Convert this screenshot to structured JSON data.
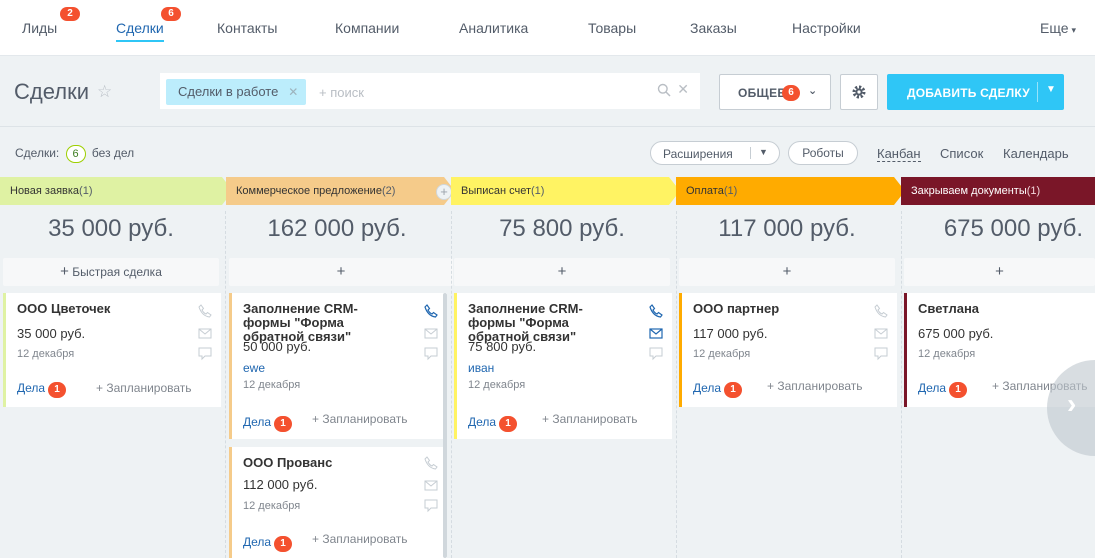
{
  "nav": {
    "items": [
      {
        "label": "Лиды",
        "counter": "2"
      },
      {
        "label": "Сделки",
        "counter": "6"
      },
      {
        "label": "Контакты"
      },
      {
        "label": "Компании"
      },
      {
        "label": "Аналитика"
      },
      {
        "label": "Товары"
      },
      {
        "label": "Заказы"
      },
      {
        "label": "Настройки"
      },
      {
        "label": "Еще"
      }
    ],
    "active": "Сделки"
  },
  "toolbar": {
    "title": "Сделки",
    "filter_chip": "Сделки в работе",
    "search_placeholder": "+ поиск",
    "general_label": "ОБЩЕЕ",
    "general_counter": "6",
    "add_label": "ДОБАВИТЬ СДЕЛКУ"
  },
  "subbar": {
    "deals_prefix": "Сделки:",
    "deals_count": "6",
    "deals_suffix": "без дел",
    "extensions_label": "Расширения",
    "robots_label": "Роботы",
    "views": [
      "Канбан",
      "Список",
      "Календарь"
    ],
    "active_view": "Канбан"
  },
  "colors": {
    "accent": "#2fc6f6",
    "counter": "#f4512f",
    "stage_new": "#dff2a3",
    "stage_offer": "#f5cb8a",
    "stage_invoice": "#fff363",
    "stage_payment": "#ffab00",
    "stage_docs": "#7a1628"
  },
  "columns": [
    {
      "stage": "Новая заявка",
      "count": "(1)",
      "sum": "35 000 руб.",
      "quick_add": "Быстрая сделка",
      "cards": [
        {
          "title": "ООО Цветочек",
          "price": "35 000 руб.",
          "date": "12 декабря",
          "activities": "Дела",
          "activities_count": "1",
          "plan": "+ Запланировать"
        }
      ]
    },
    {
      "stage": "Коммерческое предложение",
      "count": "(2)",
      "sum": "162 000 руб.",
      "quick_add": "",
      "cards": [
        {
          "title": "Заполнение CRM-формы \"Форма обратной связи\"",
          "price": "50 000 руб.",
          "contact": "ewe",
          "date": "12 декабря",
          "activities": "Дела",
          "activities_count": "1",
          "plan": "+ Запланировать"
        },
        {
          "title": "ООО Прованс",
          "price": "112 000 руб.",
          "date": "12 декабря",
          "activities": "Дела",
          "activities_count": "1",
          "plan": "+ Запланировать"
        }
      ]
    },
    {
      "stage": "Выписан счет",
      "count": "(1)",
      "sum": "75 800 руб.",
      "quick_add": "",
      "cards": [
        {
          "title": "Заполнение CRM-формы \"Форма обратной связи\"",
          "price": "75 800 руб.",
          "contact": "иван",
          "date": "12 декабря",
          "activities": "Дела",
          "activities_count": "1",
          "plan": "+ Запланировать"
        }
      ]
    },
    {
      "stage": "Оплата",
      "count": "(1)",
      "sum": "117 000 руб.",
      "quick_add": "",
      "cards": [
        {
          "title": "ООО партнер",
          "price": "117 000 руб.",
          "date": "12 декабря",
          "activities": "Дела",
          "activities_count": "1",
          "plan": "+ Запланировать"
        }
      ]
    },
    {
      "stage": "Закрываем документы",
      "count": "(1)",
      "sum": "675 000 руб.",
      "quick_add": "",
      "cards": [
        {
          "title": "Светлана",
          "price": "675 000 руб.",
          "date": "12 декабря",
          "activities": "Дела",
          "activities_count": "1",
          "plan": "+ Запланировать"
        }
      ]
    }
  ]
}
